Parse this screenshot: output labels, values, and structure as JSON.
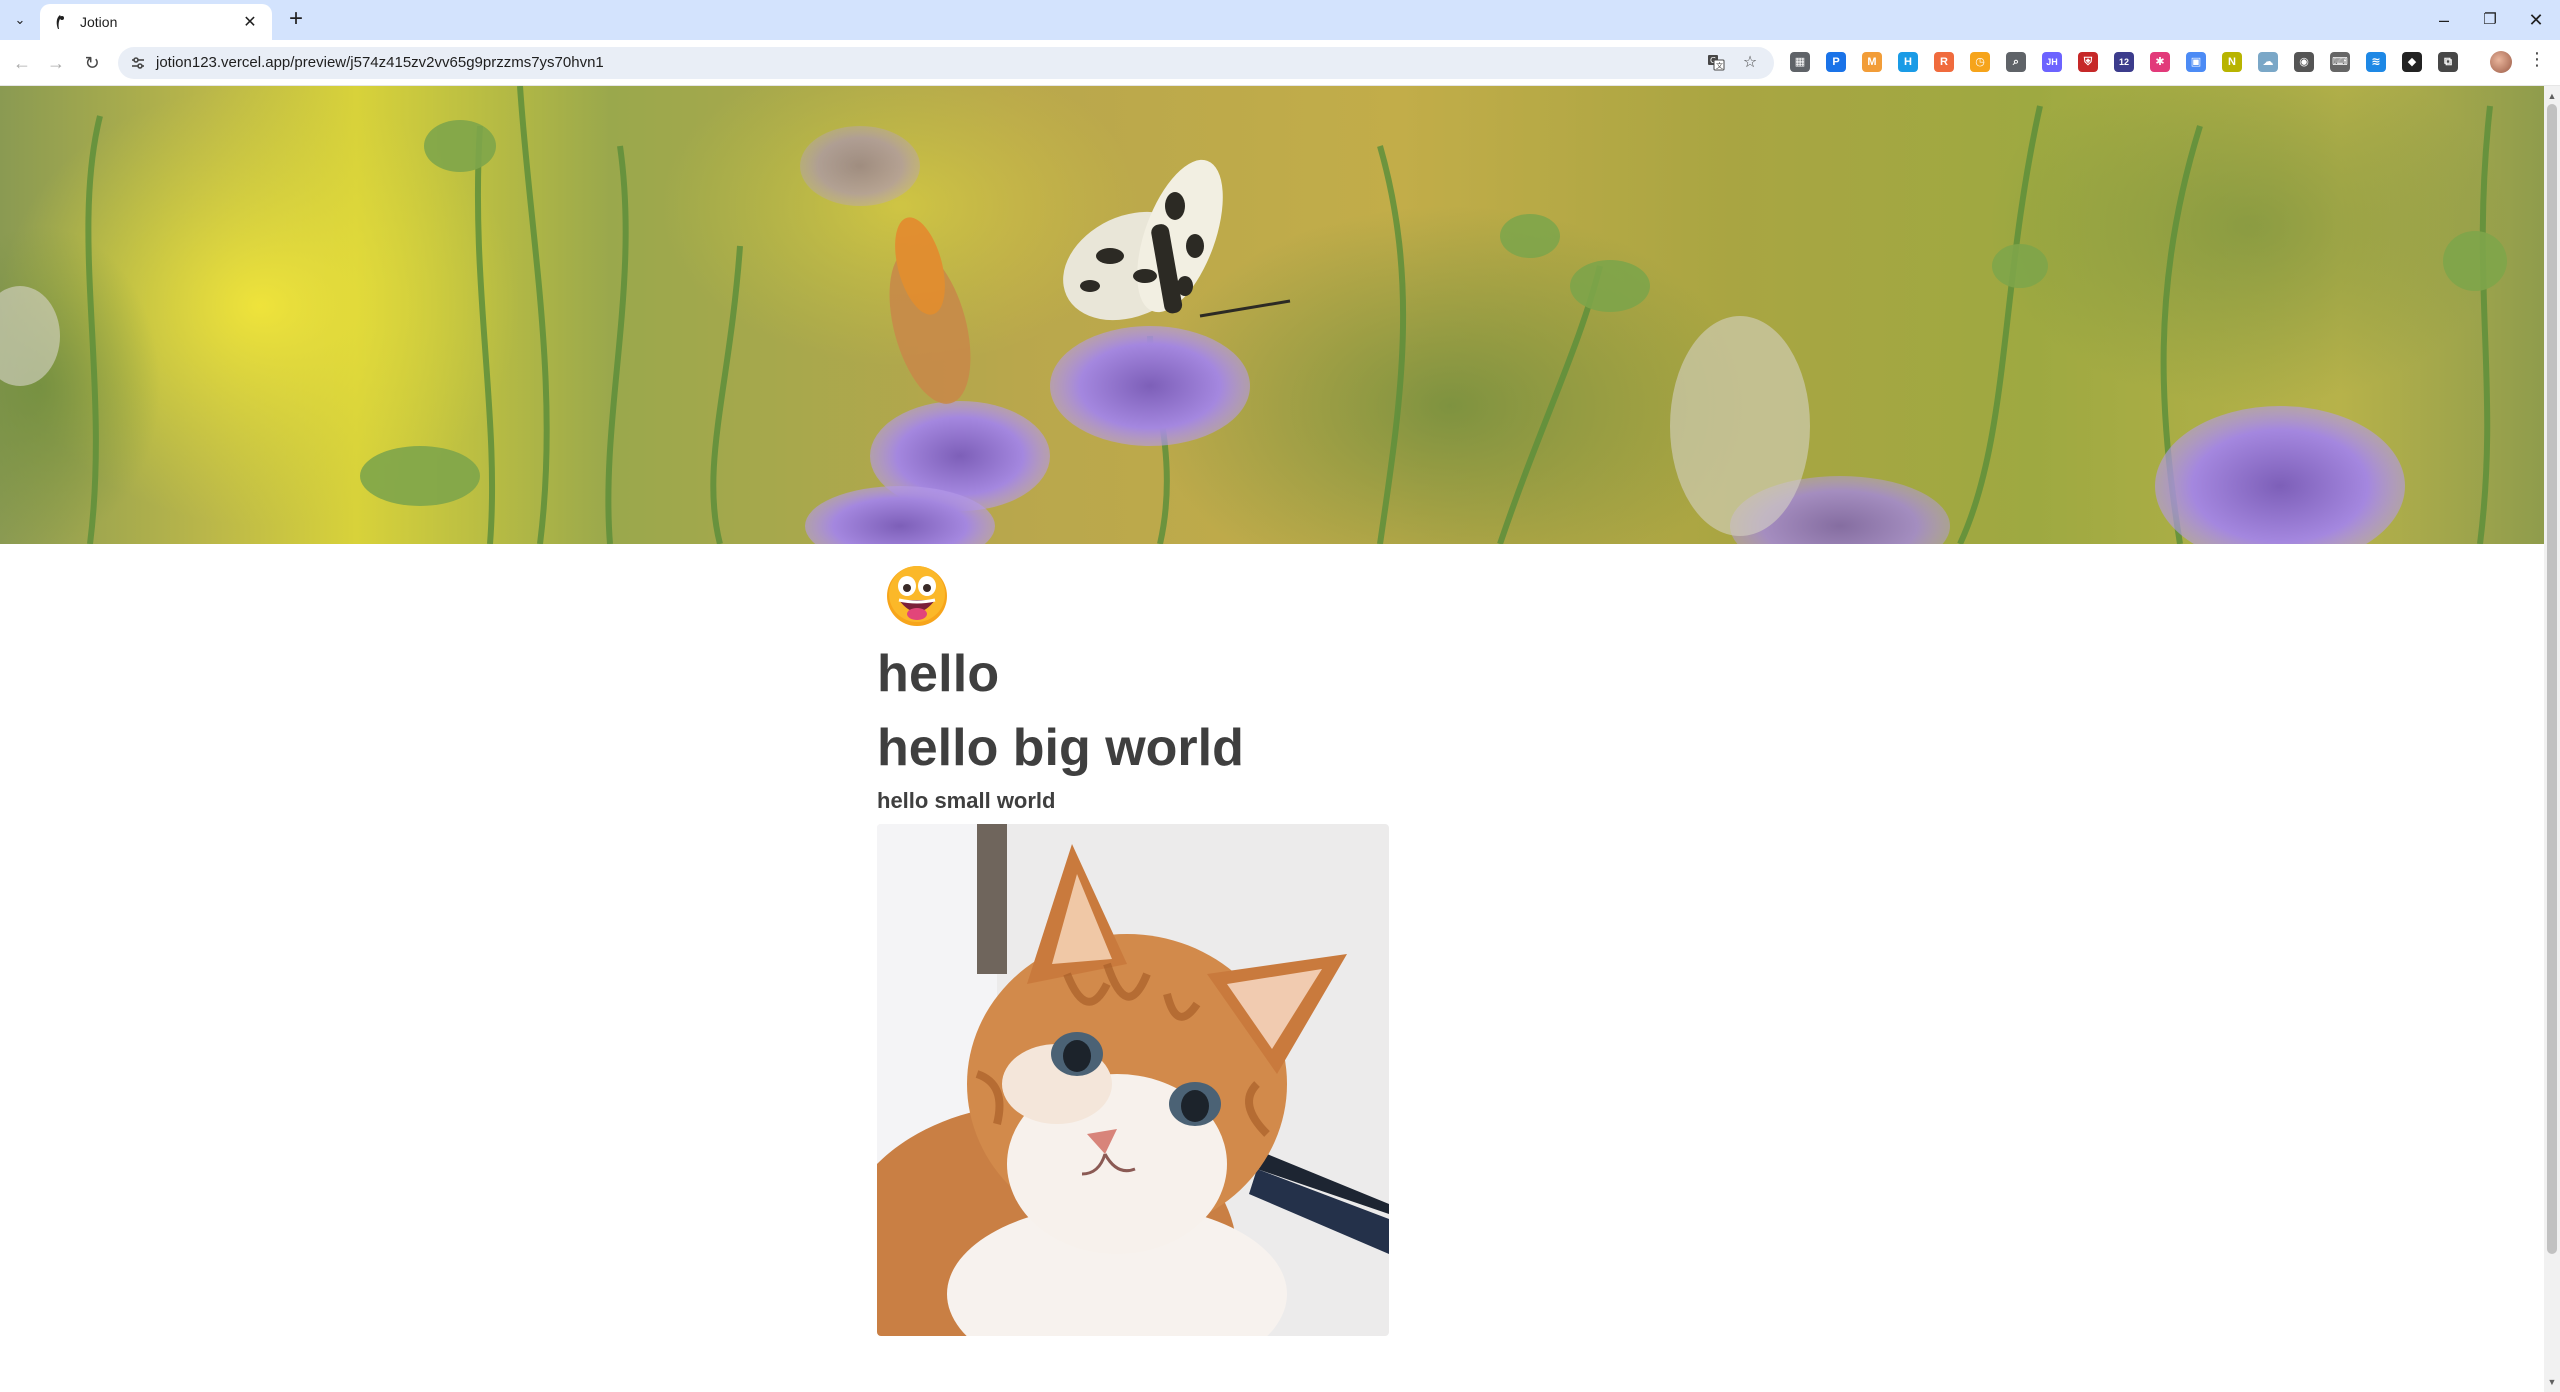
{
  "browser": {
    "tab": {
      "title": "Jotion",
      "close_glyph": "✕"
    },
    "new_tab_glyph": "+",
    "tab_list_glyph": "⌄",
    "window_controls": {
      "minimize": "–",
      "restore": "❐",
      "close": "✕"
    },
    "nav": {
      "back": "←",
      "forward": "→",
      "reload": "↻"
    },
    "address": "jotion123.vercel.app/preview/j574z415zv2vv65g9przzms7ys70hvn1",
    "extensions": [
      {
        "name": "store-icon",
        "color": "#5f6368",
        "glyph": "▦"
      },
      {
        "name": "paypal-icon",
        "color": "#1a73e8",
        "glyph": "P"
      },
      {
        "name": "gmail-icon",
        "color": "#f29d38",
        "glyph": "M"
      },
      {
        "name": "h-icon",
        "color": "#1a9be6",
        "glyph": "H"
      },
      {
        "name": "r-icon",
        "color": "#f06b3d",
        "glyph": "R"
      },
      {
        "name": "clock-icon",
        "color": "#f6a41b",
        "glyph": "◷"
      },
      {
        "name": "search-ext-icon",
        "color": "#5f6368",
        "glyph": "⌕"
      },
      {
        "name": "jh-icon",
        "color": "#6c63ff",
        "glyph": "JH"
      },
      {
        "name": "shield-icon",
        "color": "#c62828",
        "glyph": "⛨"
      },
      {
        "name": "calendar-icon",
        "color": "#3c3c8c",
        "glyph": "12"
      },
      {
        "name": "pink-icon",
        "color": "#e23a7a",
        "glyph": "✱"
      },
      {
        "name": "image-icon",
        "color": "#4c8bf5",
        "glyph": "▣"
      },
      {
        "name": "n-icon",
        "color": "#b8b400",
        "glyph": "N"
      },
      {
        "name": "cloud-icon",
        "color": "#7aa7c7",
        "glyph": "☁"
      },
      {
        "name": "camera-icon",
        "color": "#555555",
        "glyph": "◉"
      },
      {
        "name": "keyboard-icon",
        "color": "#666666",
        "glyph": "⌨"
      },
      {
        "name": "wave-icon",
        "color": "#1e88e5",
        "glyph": "≋"
      },
      {
        "name": "cube-icon",
        "color": "#222222",
        "glyph": "◆"
      },
      {
        "name": "puzzle-icon",
        "color": "#474747",
        "glyph": "⧉"
      }
    ],
    "menu_glyph": "⋮"
  },
  "page": {
    "emoji": "😛",
    "title": "hello",
    "heading_1": "hello big world",
    "heading_3": "hello small world"
  },
  "colors": {
    "tabbar": "#d3e3fd",
    "text": "#3f3f3f"
  }
}
